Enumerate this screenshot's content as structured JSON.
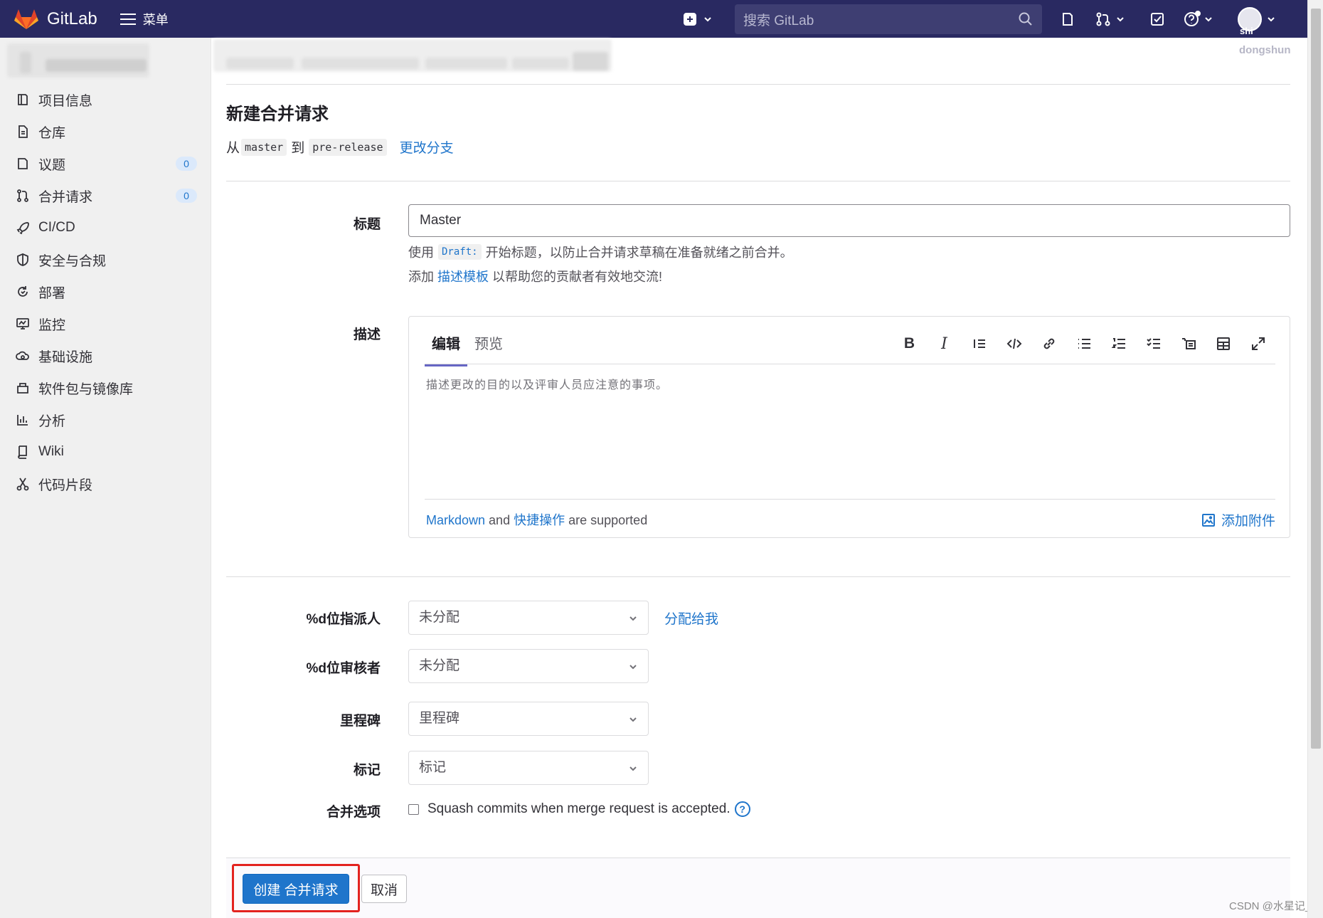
{
  "header": {
    "brand": "GitLab",
    "menu_label": "菜单",
    "search_placeholder": "搜索 GitLab",
    "avatar_label": "shi",
    "username": "dongshun"
  },
  "sidebar": {
    "items": [
      {
        "label": "项目信息",
        "icon": "info-icon"
      },
      {
        "label": "仓库",
        "icon": "document-icon"
      },
      {
        "label": "议题",
        "icon": "issues-icon",
        "count": "0"
      },
      {
        "label": "合并请求",
        "icon": "merge-request-icon",
        "count": "0"
      },
      {
        "label": "CI/CD",
        "icon": "rocket-icon"
      },
      {
        "label": "安全与合规",
        "icon": "shield-icon"
      },
      {
        "label": "部署",
        "icon": "deploy-icon"
      },
      {
        "label": "监控",
        "icon": "monitor-icon"
      },
      {
        "label": "基础设施",
        "icon": "cloud-gear-icon"
      },
      {
        "label": "软件包与镜像库",
        "icon": "package-icon"
      },
      {
        "label": "分析",
        "icon": "chart-icon"
      },
      {
        "label": "Wiki",
        "icon": "book-icon"
      },
      {
        "label": "代码片段",
        "icon": "scissors-icon"
      }
    ]
  },
  "main": {
    "title": "新建合并请求",
    "branch": {
      "from_text": "从",
      "source": "master",
      "to_text": "到",
      "target": "pre-release",
      "change_link": "更改分支"
    },
    "form": {
      "title_label": "标题",
      "title_value": "Master",
      "hint1_pre": "使用",
      "hint1_code": "Draft:",
      "hint1_post": "开始标题，以防止合并请求草稿在准备就绪之前合并。",
      "hint2_pre": "添加",
      "hint2_link": "描述模板",
      "hint2_post": "以帮助您的贡献者有效地交流!",
      "desc_label": "描述",
      "tab_edit": "编辑",
      "tab_preview": "预览",
      "toolbar": [
        "bold-icon",
        "italic-icon",
        "quote-icon",
        "code-icon",
        "link-icon",
        "bullet-list-icon",
        "numbered-list-icon",
        "task-list-icon",
        "collapsible-icon",
        "table-icon",
        "fullscreen-icon"
      ],
      "desc_placeholder": "描述更改的目的以及评审人员应注意的事项。",
      "markdown_link": "Markdown",
      "footer_and": "and",
      "quick_actions_link": "快捷操作",
      "footer_supported": "are supported",
      "attach_label": "添加附件",
      "assignee_label": "%d位指派人",
      "assignee_value": "未分配",
      "assign_me": "分配给我",
      "reviewer_label": "%d位审核者",
      "reviewer_value": "未分配",
      "milestone_label": "里程碑",
      "milestone_value": "里程碑",
      "labels_label": "标记",
      "labels_value": "标记",
      "merge_options_label": "合并选项",
      "squash_text": "Squash commits when merge request is accepted."
    },
    "buttons": {
      "create": "创建 合并请求",
      "cancel": "取消"
    }
  },
  "watermark": "CSDN @水星记_",
  "colors": {
    "navbar": "#292961",
    "link": "#1f75cb",
    "primary": "#1f75cb",
    "highlight": "#e3231f"
  }
}
